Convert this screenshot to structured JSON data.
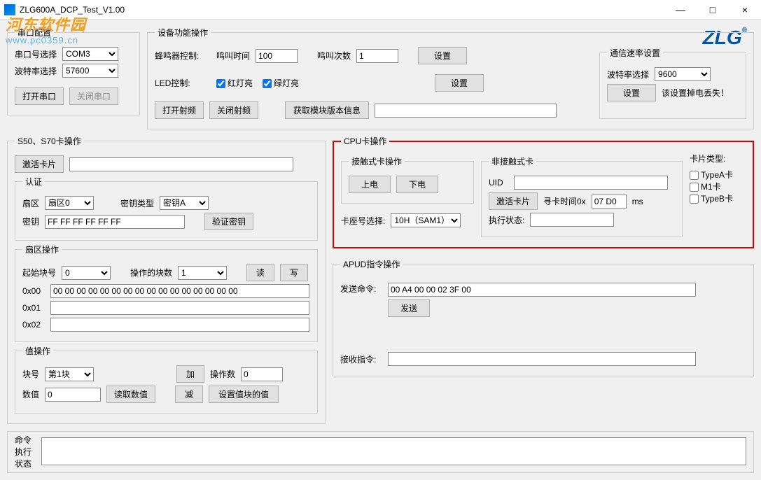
{
  "window": {
    "title": "ZLG600A_DCP_Test_V1.00",
    "min": "—",
    "max": "□",
    "close": "×"
  },
  "watermark": {
    "text1": "河东软件园",
    "text2": "www.pc0359.cn"
  },
  "logo": "ZLG",
  "serial": {
    "title": "串口配置",
    "port_label": "串口号选择",
    "port_value": "COM3",
    "baud_label": "波特率选择",
    "baud_value": "57600",
    "open": "打开串口",
    "close": "关闭串口"
  },
  "device": {
    "title": "设备功能操作",
    "buzzer_label": "蜂鸣器控制:",
    "ring_time_label": "鸣叫时间",
    "ring_time_value": "100",
    "ring_count_label": "鸣叫次数",
    "ring_count_value": "1",
    "set": "设置",
    "led_label": "LED控制:",
    "red_led": "红灯亮",
    "green_led": "绿灯亮",
    "open_rf": "打开射频",
    "close_rf": "关闭射频",
    "get_version": "获取模块版本信息",
    "version_value": ""
  },
  "commrate": {
    "title": "通信速率设置",
    "baud_label": "波特率选择",
    "baud_value": "9600",
    "set": "设置",
    "note": "该设置掉电丢失！"
  },
  "s50": {
    "title": "S50、S70卡操作",
    "activate": "激活卡片",
    "activate_value": "",
    "auth": {
      "title": "认证",
      "sector_label": "扇区",
      "sector_value": "扇区0",
      "keytype_label": "密钥类型",
      "keytype_value": "密钥A",
      "key_label": "密钥",
      "key_value": "FF FF FF FF FF FF",
      "verify": "验证密钥"
    },
    "sectorop": {
      "title": "扇区操作",
      "startblock_label": "起始块号",
      "startblock_value": "0",
      "blockcount_label": "操作的块数",
      "blockcount_value": "1",
      "read": "读",
      "write": "写",
      "row0_label": "0x00",
      "row0_value": "00 00 00 00 00 00 00 00 00 00 00 00 00 00 00 00",
      "row1_label": "0x01",
      "row1_value": "",
      "row2_label": "0x02",
      "row2_value": ""
    },
    "valueop": {
      "title": "值操作",
      "block_label": "块号",
      "block_value": "第1块",
      "add": "加",
      "sub": "减",
      "opcount_label": "操作数",
      "opcount_value": "0",
      "value_label": "数值",
      "value_value": "0",
      "readvalue": "读取数值",
      "setvalue": "设置值块的值"
    }
  },
  "cpu": {
    "title": "CPU卡操作",
    "contact": {
      "title": "接触式卡操作",
      "poweron": "上电",
      "poweroff": "下电"
    },
    "slot_label": "卡座号选择:",
    "slot_value": "10H（SAM1）",
    "noncontact": {
      "title": "非接触式卡",
      "uid_label": "UID",
      "uid_value": "",
      "activate": "激活卡片",
      "seek_label": "寻卡时间0x",
      "seek_value": "07 D0",
      "seek_unit": "ms",
      "status_label": "执行状态:",
      "status_value": ""
    },
    "cardtype": {
      "title": "卡片类型:",
      "typea": "TypeA卡",
      "m1": "M1卡",
      "typeb": "TypeB卡"
    }
  },
  "apdu": {
    "title": "APUD指令操作",
    "send_label": "发送命令:",
    "send_value": "00 A4 00 00 02 3F 00",
    "send_btn": "发送",
    "recv_label": "接收指令:",
    "recv_value": ""
  },
  "status": {
    "label": "命令\n执行\n状态",
    "value": ""
  }
}
